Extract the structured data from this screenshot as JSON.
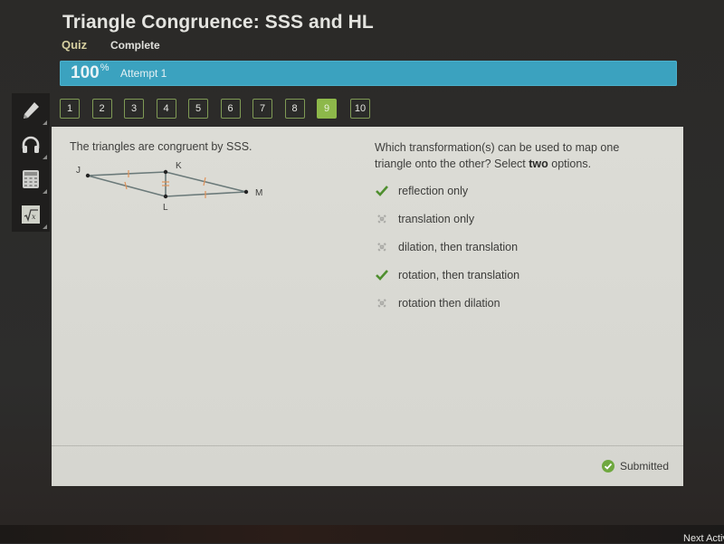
{
  "header": {
    "title": "Triangle Congruence: SSS and HL",
    "type_label": "Quiz",
    "status_label": "Complete"
  },
  "progress": {
    "percent_value": "100",
    "percent_sign": "%",
    "attempt_label": "Attempt 1",
    "fraction": 1.0,
    "color": "#3ba2bf"
  },
  "sidebar": {
    "tools": [
      {
        "name": "pencil",
        "icon": "pencil-icon"
      },
      {
        "name": "audio",
        "icon": "headphones-icon"
      },
      {
        "name": "calculator",
        "icon": "calculator-icon"
      },
      {
        "name": "formula",
        "icon": "square-root-icon"
      }
    ]
  },
  "question_nav": {
    "items": [
      {
        "label": "1",
        "active": false
      },
      {
        "label": "2",
        "active": false
      },
      {
        "label": "3",
        "active": false
      },
      {
        "label": "4",
        "active": false
      },
      {
        "label": "5",
        "active": false
      },
      {
        "label": "6",
        "active": false
      },
      {
        "label": "7",
        "active": false
      },
      {
        "label": "8",
        "active": false
      },
      {
        "label": "9",
        "active": true
      },
      {
        "label": "10",
        "active": false
      }
    ],
    "active_color": "#8db84a",
    "border_color": "#7f9a55"
  },
  "question": {
    "statement": "The triangles are congruent by SSS.",
    "figure": {
      "vertices": [
        "J",
        "K",
        "L",
        "M"
      ],
      "congruent_marks": "JK ≅ LM (single tick), JL ≅ KM (single tick), KL shared (double tick)"
    },
    "prompt_part1": "Which transformation(s) can be used to map one triangle onto the other? Select ",
    "prompt_bold": "two",
    "prompt_part2": " options.",
    "options": [
      {
        "label": "reflection only",
        "status": "correct",
        "icon": "check-icon"
      },
      {
        "label": "translation only",
        "status": "incorrect",
        "icon": "x-icon"
      },
      {
        "label": "dilation, then translation",
        "status": "incorrect",
        "icon": "x-icon"
      },
      {
        "label": "rotation, then translation",
        "status": "correct",
        "icon": "check-icon"
      },
      {
        "label": "rotation then dilation",
        "status": "incorrect",
        "icon": "x-icon"
      }
    ],
    "correct_color": "#4f8f2f",
    "incorrect_color": "#a9a9a5"
  },
  "footer": {
    "submitted_label": "Submitted",
    "submitted_color": "#6fa83f",
    "next_activity_label": "Next Activity"
  }
}
